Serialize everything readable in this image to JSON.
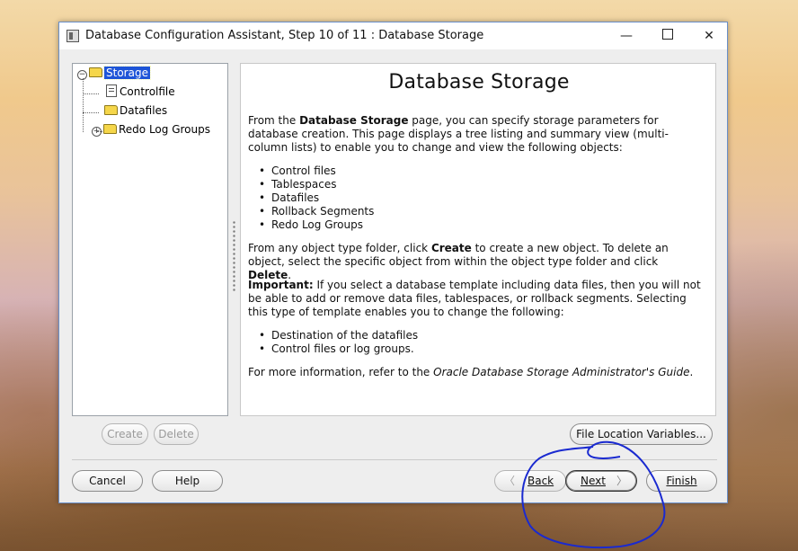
{
  "window": {
    "title": "Database Configuration Assistant, Step 10 of 11 : Database Storage",
    "min_glyph": "—",
    "close_glyph": "✕"
  },
  "tree": {
    "root": "Storage",
    "items": [
      "Controlfile",
      "Datafiles",
      "Redo Log Groups"
    ]
  },
  "content": {
    "heading": "Database Storage",
    "p1_a": "From the ",
    "p1_b": "Database Storage",
    "p1_c": " page, you can specify storage parameters for database creation. This page displays a tree listing and summary view (multi-column lists) to enable you to change and view the following objects:",
    "list1": [
      "Control files",
      "Tablespaces",
      "Datafiles",
      "Rollback Segments",
      "Redo Log Groups"
    ],
    "p2_a": "From any object type folder, click ",
    "p2_b": "Create",
    "p2_c": " to create a new object. To delete an object, select the specific object from within the object type folder and click ",
    "p2_d": "Delete",
    "p2_e": ".",
    "p3_a": "Important:",
    "p3_b": " If you select a database template including data files, then you will not be able to add or remove data files, tablespaces, or rollback segments. Selecting this type of template enables you to change the following:",
    "list2": [
      "Destination of the datafiles",
      "Control files or log groups."
    ],
    "p4_a": "For more information, refer to the ",
    "p4_b": "Oracle Database Storage Administrator's Guide",
    "p4_c": "."
  },
  "buttons": {
    "create": "Create",
    "delete": "Delete",
    "file_location": "File Location Variables...",
    "cancel": "Cancel",
    "help": "Help",
    "back": "Back",
    "next": "Next",
    "finish": "Finish"
  },
  "colors": {
    "selection": "#1e55d8",
    "annotation": "#1a2ad0"
  }
}
